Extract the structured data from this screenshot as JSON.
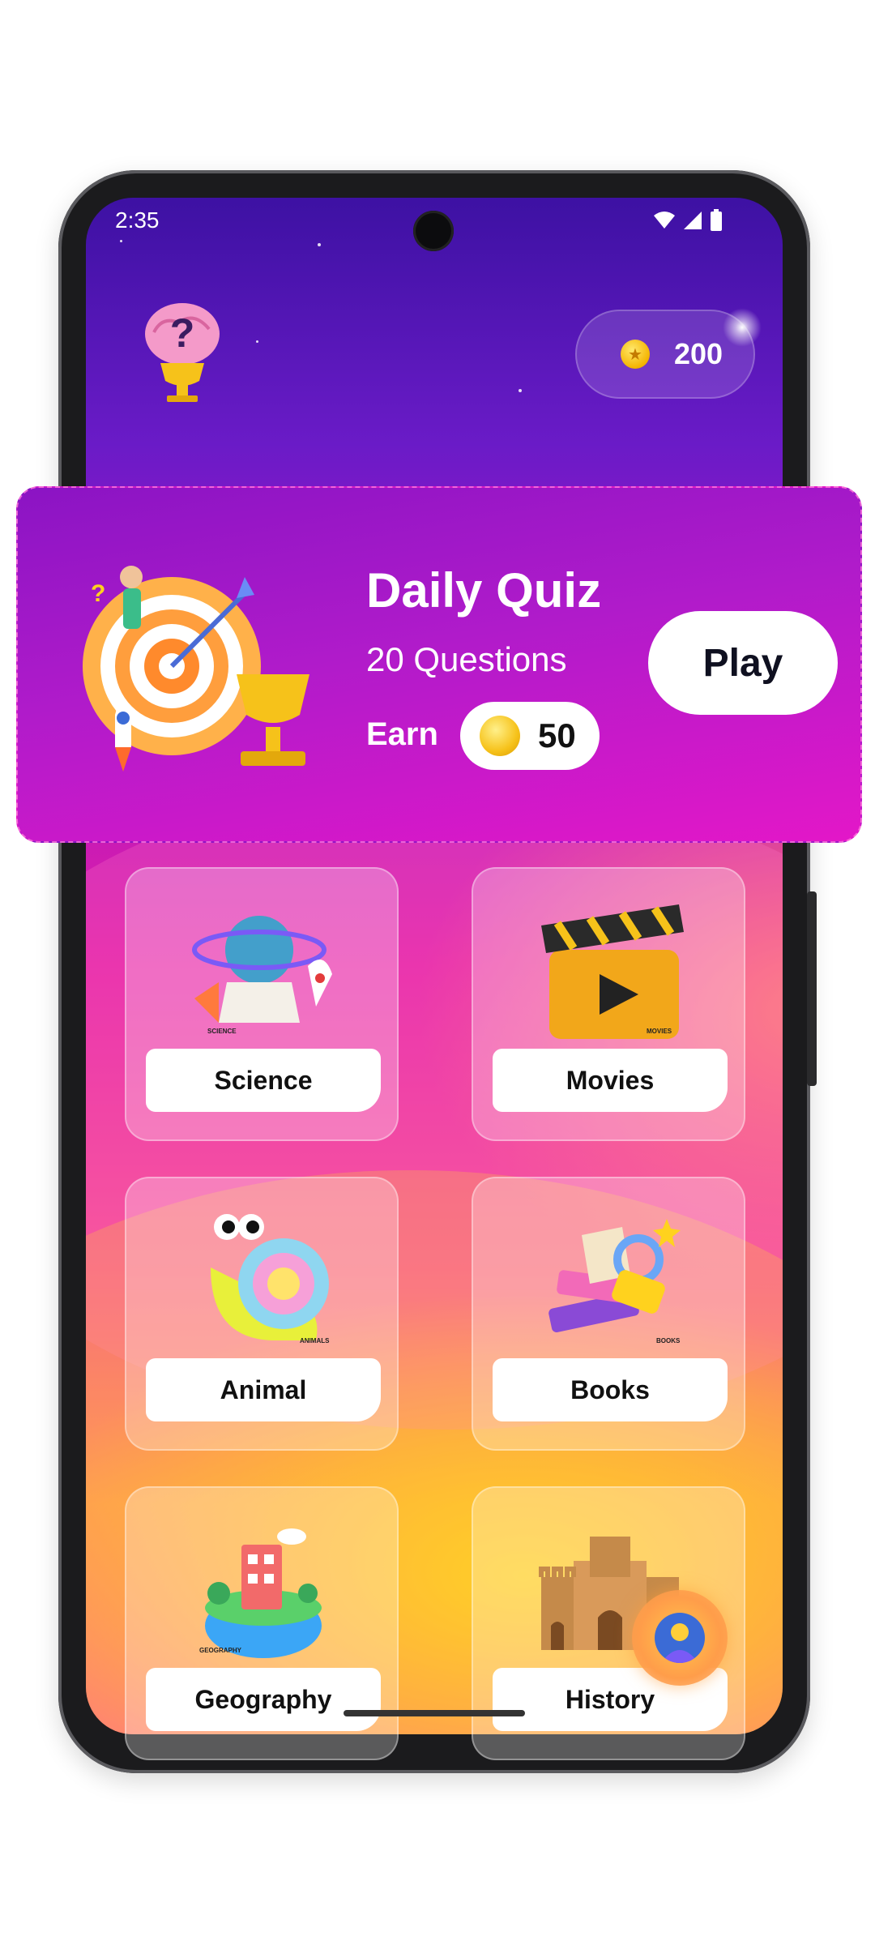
{
  "status_bar": {
    "time": "2:35"
  },
  "header": {
    "coins": "200"
  },
  "daily_quiz": {
    "title": "Daily Quiz",
    "subtitle": "20 Questions",
    "earn_label": "Earn",
    "earn_value": "50",
    "play_label": "Play"
  },
  "categories": [
    {
      "label": "Science",
      "icon": "science-icon",
      "tag": "SCIENCE"
    },
    {
      "label": "Movies",
      "icon": "movies-clapperboard-icon",
      "tag": "MOVIES"
    },
    {
      "label": "Animal",
      "icon": "snail-icon",
      "tag": "ANIMALS"
    },
    {
      "label": "Books",
      "icon": "books-icon",
      "tag": "BOOKS"
    },
    {
      "label": "Geography",
      "icon": "globe-island-icon",
      "tag": "GEOGRAPHY"
    },
    {
      "label": "History",
      "icon": "castle-icon",
      "tag": ""
    }
  ],
  "colors": {
    "bg_top": "#3d11a3",
    "bg_mid": "#e31fa6",
    "bg_bottom": "#ffd21e",
    "card": "#b01bca",
    "coin": "#f4b400"
  }
}
